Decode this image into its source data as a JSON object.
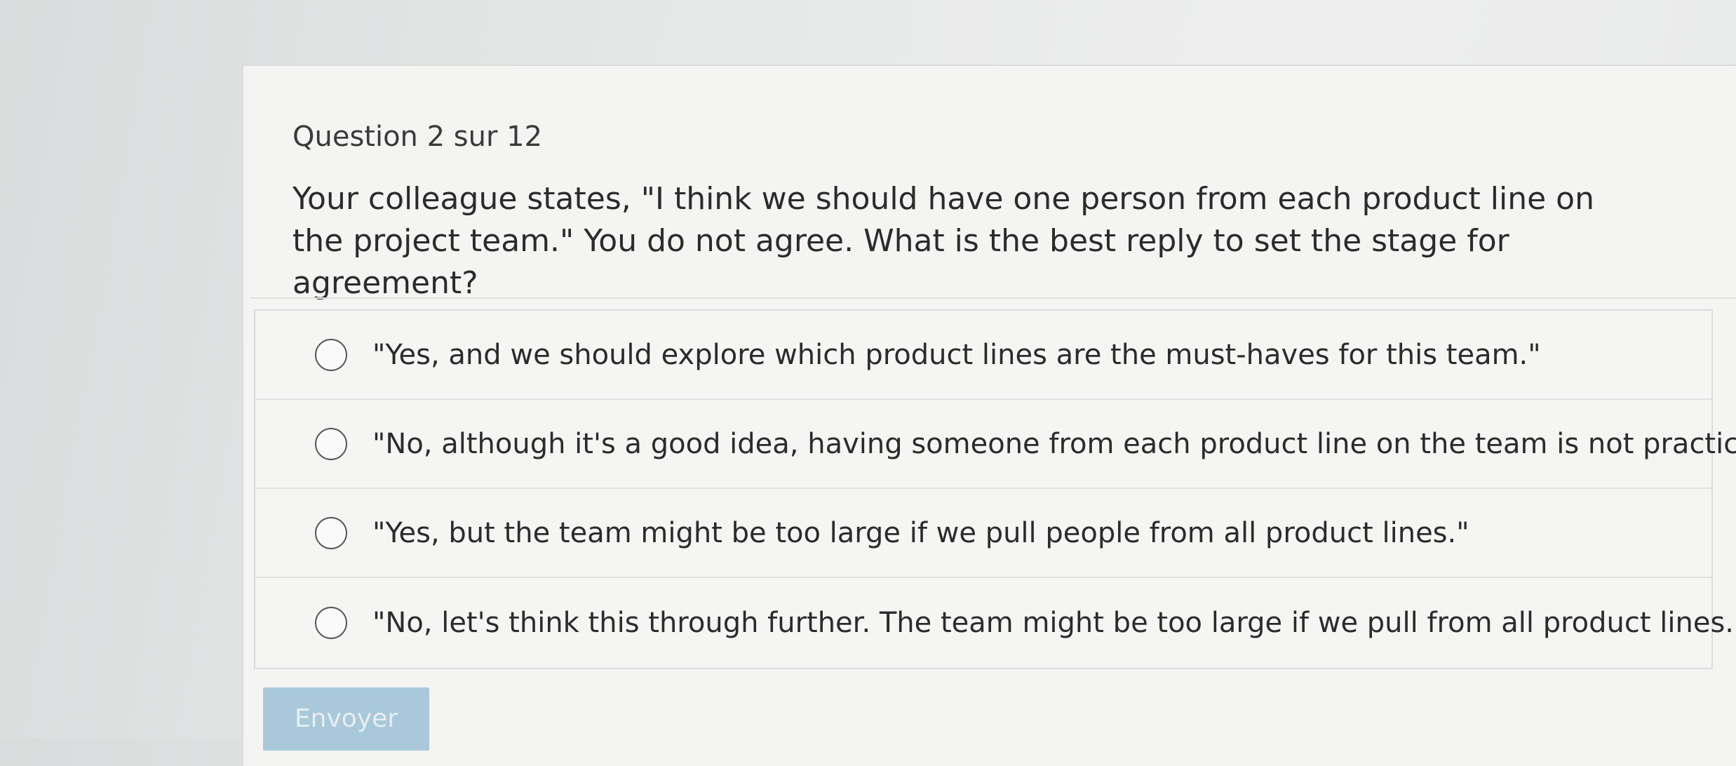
{
  "quiz": {
    "header": "Question 2 sur 12",
    "question": "Your colleague states, \"I think we should have one person from each product line on the project team.\" You do not agree. What is the best reply to set the stage for agreement?",
    "options": [
      {
        "label": "\"Yes, and we should explore which product lines are the must-haves for this team.\"",
        "selected": false
      },
      {
        "label": "\"No, although it's a good idea, having someone from each product line on the team is not practical.\"",
        "selected": false
      },
      {
        "label": "\"Yes, but the team might be too large if we pull people from all product lines.\"",
        "selected": false
      },
      {
        "label": "\"No, let's think this through further. The team might be too large if we pull from all product lines.\"",
        "selected": false
      }
    ],
    "submit_label": "Envoyer"
  },
  "colors": {
    "submit_button": "#a9c9da",
    "radio_border": "#555555"
  }
}
